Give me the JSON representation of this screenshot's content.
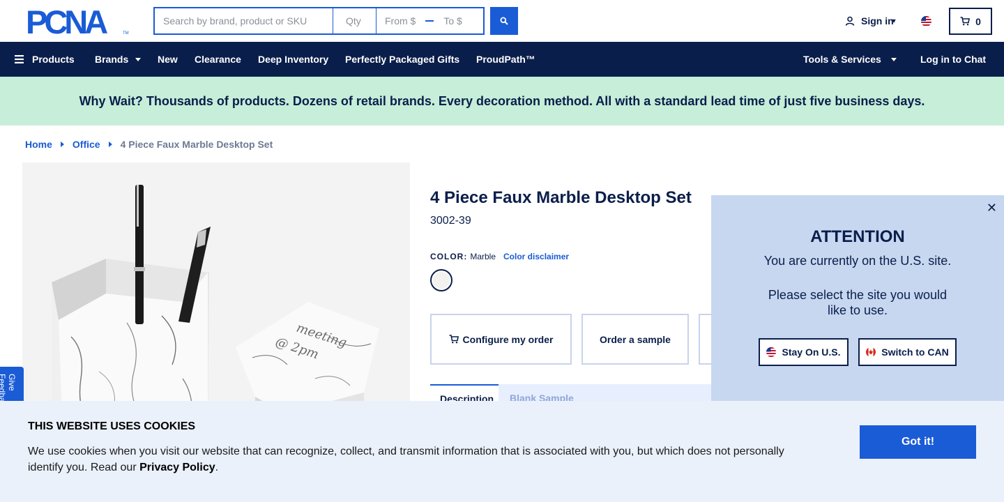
{
  "header": {
    "logo_text": "PCNA",
    "search_placeholder": "Search by brand, product or SKU",
    "qty_placeholder": "Qty",
    "price_from": "From $",
    "price_to": "To $",
    "signin_label": "Sign in",
    "cart_count": "0"
  },
  "nav": {
    "products": "Products",
    "brands": "Brands",
    "new": "New",
    "clearance": "Clearance",
    "deep_inventory": "Deep Inventory",
    "gifts": "Perfectly Packaged Gifts",
    "proudpath": "ProudPath™",
    "tools": "Tools & Services",
    "chat": "Log in to Chat"
  },
  "banner": {
    "text": "Why Wait? Thousands of products. Dozens of retail brands. Every decoration method. All with a standard lead time of just five business days."
  },
  "breadcrumb": {
    "home": "Home",
    "office": "Office",
    "current": "4 Piece Faux Marble Desktop Set"
  },
  "product": {
    "title": "4 Piece Faux Marble Desktop Set",
    "sku": "3002-39",
    "color_label": "COLOR:",
    "color_value": "Marble",
    "color_disclaimer": "Color disclaimer",
    "configure_label": "Configure my order",
    "sample_label": "Order a sample",
    "tab_description": "Description",
    "tab_blank": "Blank Sample"
  },
  "feedback": {
    "label": "Give Feedback"
  },
  "attention": {
    "title": "ATTENTION",
    "text1": "You are currently on the U.S. site.",
    "text2": "Please select the site you would like to use.",
    "stay_label": "Stay On U.S.",
    "switch_label": "Switch to CAN"
  },
  "cookie": {
    "title": "THIS WEBSITE USES COOKIES",
    "text_before": "We use cookies when you visit our website that can recognize, collect, and transmit information that is associated with you, but which does not personally identify you. Read our ",
    "privacy_link": "Privacy Policy",
    "text_after": ".",
    "button": "Got it!"
  },
  "colors": {
    "navy": "#0a1e4b",
    "blue": "#1a5bd6",
    "banner_green": "#c6eed8",
    "modal_blue": "#c7d7f0",
    "cookie_bg": "#eaf1fb"
  }
}
